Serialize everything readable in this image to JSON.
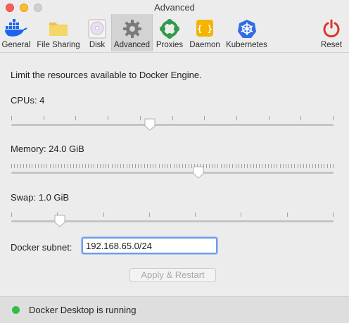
{
  "window": {
    "title": "Advanced"
  },
  "toolbar": {
    "items": [
      {
        "label": "General",
        "icon": "docker-whale-icon"
      },
      {
        "label": "File Sharing",
        "icon": "folder-icon"
      },
      {
        "label": "Disk",
        "icon": "disk-icon"
      },
      {
        "label": "Advanced",
        "icon": "gear-icon",
        "active": true
      },
      {
        "label": "Proxies",
        "icon": "proxies-icon"
      },
      {
        "label": "Daemon",
        "icon": "daemon-icon"
      },
      {
        "label": "Kubernetes",
        "icon": "kubernetes-icon"
      }
    ],
    "reset": {
      "label": "Reset",
      "icon": "power-icon"
    }
  },
  "main": {
    "intro": "Limit the resources available to Docker Engine.",
    "cpus": {
      "label": "CPUs: 4",
      "fraction": 0.43
    },
    "memory": {
      "label": "Memory: 24.0 GiB",
      "fraction": 0.58
    },
    "swap": {
      "label": "Swap: 1.0 GiB",
      "fraction": 0.15
    },
    "subnet": {
      "label": "Docker subnet:",
      "value": "192.168.65.0/24"
    },
    "apply_label": "Apply & Restart"
  },
  "status": {
    "text": "Docker Desktop is running",
    "color": "#2fbf48"
  },
  "colors": {
    "accent": "#6f9ce8",
    "reset_red": "#d9362b"
  }
}
